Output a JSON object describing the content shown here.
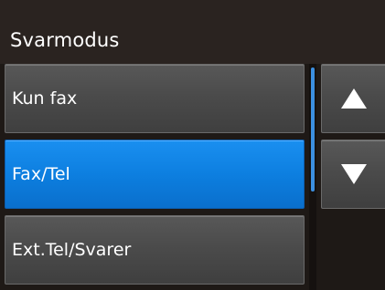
{
  "header": {
    "title": "Svarmodus"
  },
  "list": {
    "items": [
      {
        "label": "Kun fax",
        "selected": false
      },
      {
        "label": "Fax/Tel",
        "selected": true
      },
      {
        "label": "Ext.Tel/Svarer",
        "selected": false
      }
    ]
  },
  "scroll": {
    "up_icon": "triangle-up",
    "down_icon": "triangle-down"
  },
  "colors": {
    "background": "#1e1916",
    "header_bg": "#2a2320",
    "item_bg": "#4b4b4b",
    "selected_bg": "#0d7fe0",
    "scroll_thumb": "#3c8fe0",
    "text": "#ffffff"
  }
}
